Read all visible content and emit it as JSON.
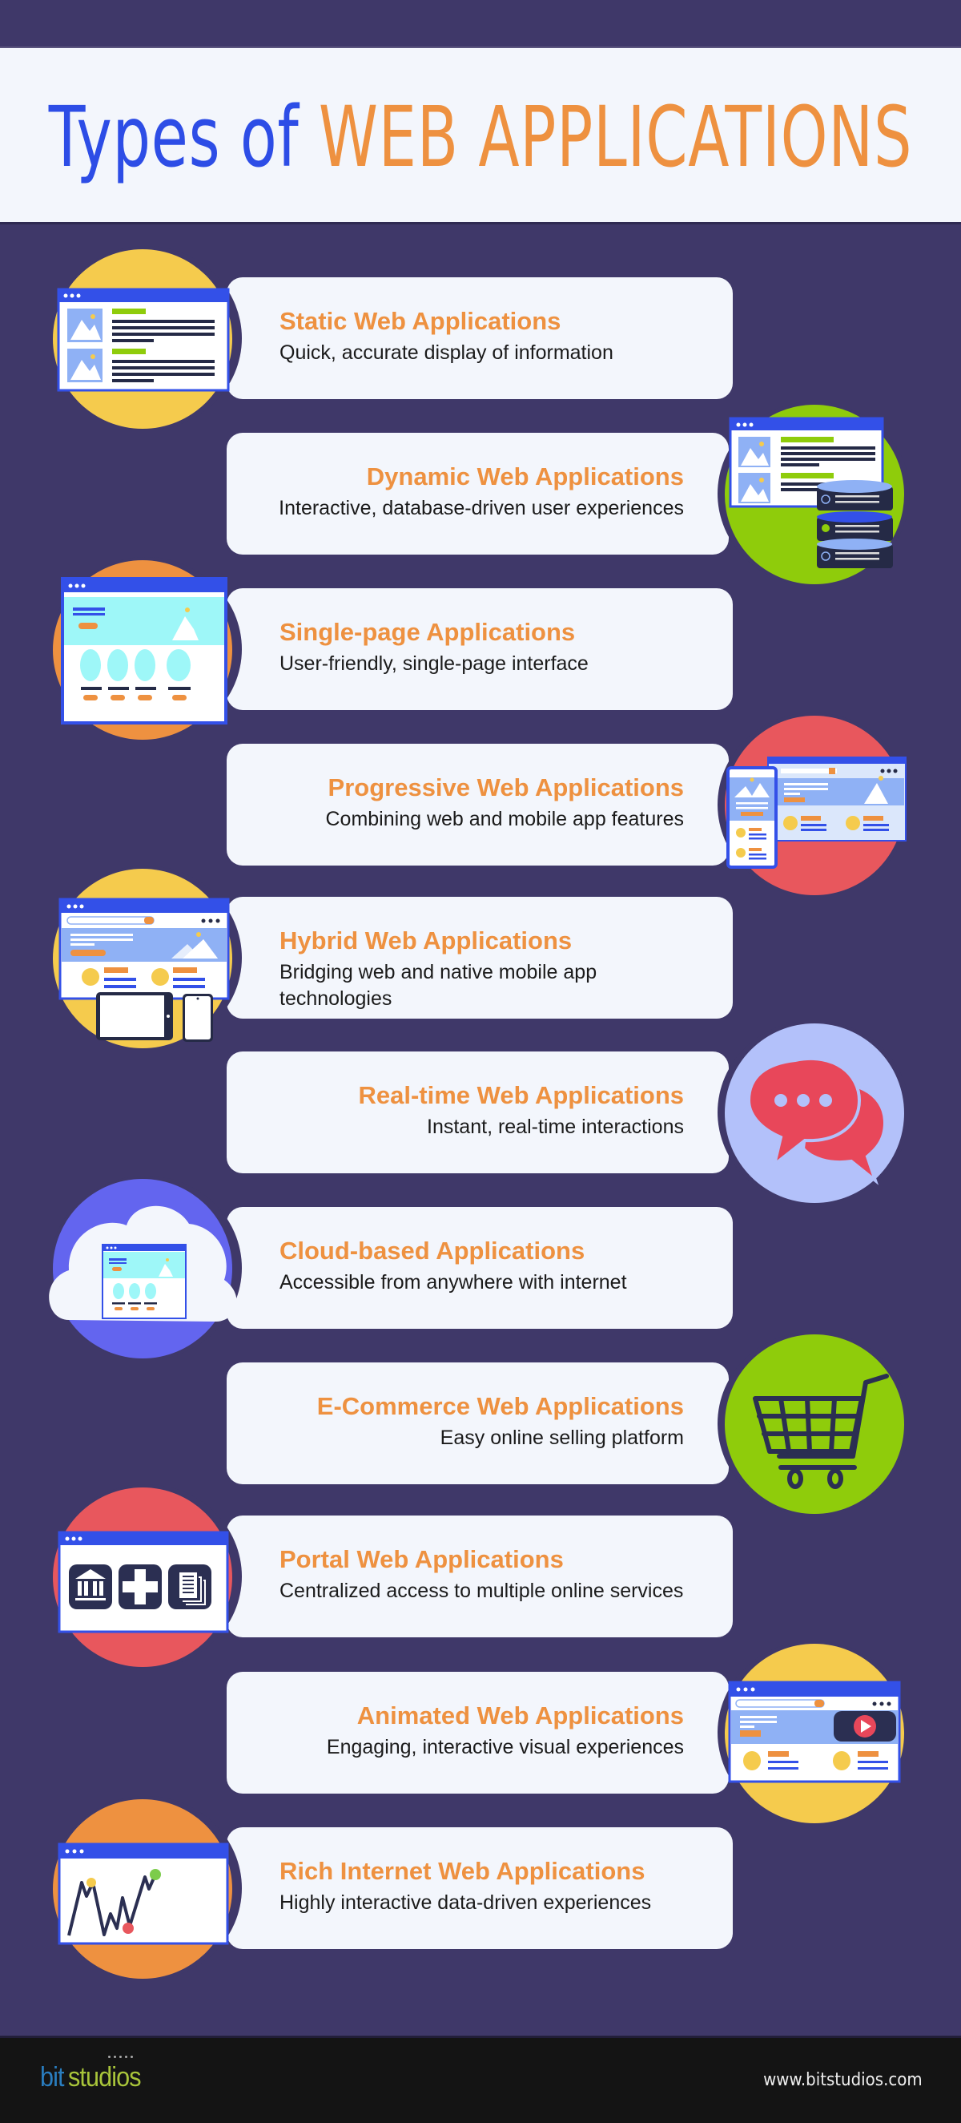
{
  "header": {
    "title_part1": "Types of",
    "title_part2": "WEB APPLICATIONS"
  },
  "colors": {
    "background": "#3f3869",
    "card": "#f3f6fc",
    "title_blue": "#2d4de6",
    "accent_orange": "#ee9140",
    "yellow": "#f5cb4d",
    "green": "#8fcc0b",
    "orange": "#ee9140",
    "red": "#e8575d",
    "lavender": "#b3c1fa",
    "periwinkle": "#6365ef"
  },
  "items": [
    {
      "title": "Static Web Applications",
      "description": "Quick, accurate display of information",
      "icon": "static-page-icon",
      "circle_color": "#f5cb4d",
      "side": "left"
    },
    {
      "title": "Dynamic Web Applications",
      "description": "Interactive, database-driven user experiences",
      "icon": "database-page-icon",
      "circle_color": "#8fcc0b",
      "side": "right"
    },
    {
      "title": "Single-page Applications",
      "description": "User-friendly, single-page interface",
      "icon": "single-page-icon",
      "circle_color": "#ee9140",
      "side": "left"
    },
    {
      "title": "Progressive Web Applications",
      "description": "Combining web and mobile app features",
      "icon": "desktop-mobile-icon",
      "circle_color": "#e8575d",
      "side": "right"
    },
    {
      "title": "Hybrid Web Applications",
      "description": "Bridging web and native mobile app technologies",
      "icon": "multi-device-icon",
      "circle_color": "#f5cb4d",
      "side": "left"
    },
    {
      "title": "Real-time Web Applications",
      "description": "Instant, real-time interactions",
      "icon": "chat-bubbles-icon",
      "circle_color": "#b3c1fa",
      "side": "right"
    },
    {
      "title": "Cloud-based Applications",
      "description": "Accessible from anywhere with internet",
      "icon": "cloud-page-icon",
      "circle_color": "#6365ef",
      "side": "left"
    },
    {
      "title": "E-Commerce Web Applications",
      "description": "Easy online selling platform",
      "icon": "shopping-cart-icon",
      "circle_color": "#8fcc0b",
      "side": "right"
    },
    {
      "title": "Portal Web Applications",
      "description": "Centralized access to multiple online services",
      "icon": "portal-services-icon",
      "circle_color": "#e8575d",
      "side": "left"
    },
    {
      "title": "Animated Web Applications",
      "description": "Engaging, interactive visual experiences",
      "icon": "video-play-page-icon",
      "circle_color": "#f5cb4d",
      "side": "right"
    },
    {
      "title": "Rich Internet Web Applications",
      "description": "Highly interactive data-driven experiences",
      "icon": "line-graph-page-icon",
      "circle_color": "#ee9140",
      "side": "left"
    }
  ],
  "footer": {
    "logo_part1": "bit",
    "logo_part2": "studios",
    "website": "www.bitstudios.com"
  }
}
